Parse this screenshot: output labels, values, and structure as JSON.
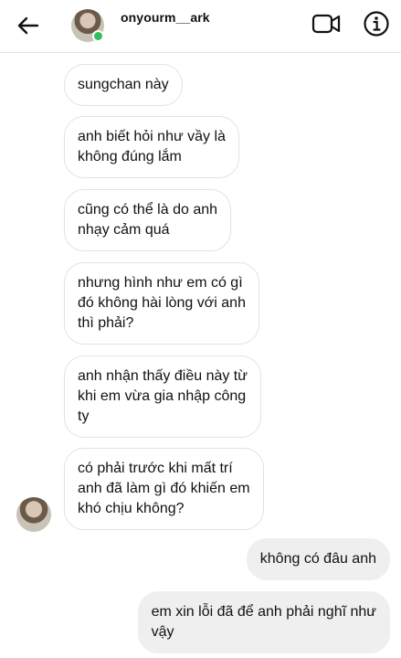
{
  "header": {
    "username": "onyourm__ark",
    "back_icon": "arrow-left-icon",
    "video_icon": "video-camera-icon",
    "info_icon": "info-circle-icon"
  },
  "messages": [
    {
      "sender": "other",
      "text": "sungchan này"
    },
    {
      "sender": "other",
      "text": "anh biết hỏi như vầy là\nkhông đúng lắm"
    },
    {
      "sender": "other",
      "text": "cũng có thể là do anh\nnhạy cảm quá"
    },
    {
      "sender": "other",
      "text": "nhưng hình như em có gì\nđó không hài lòng với anh\nthì phải?"
    },
    {
      "sender": "other",
      "text": "anh nhận thấy điều này từ\nkhi em vừa gia nhập công\nty"
    },
    {
      "sender": "other",
      "text": "có phải trước khi mất trí\nanh đã làm gì đó khiến em\nkhó chịu không?"
    },
    {
      "sender": "me",
      "text": "không có đâu anh"
    },
    {
      "sender": "me",
      "text": "em xin lỗi đã để anh phải nghĩ như\nvậy"
    }
  ],
  "colors": {
    "online": "#2fbf5b",
    "incoming_border": "#e2e2e2",
    "outgoing_bg": "#efefef"
  }
}
